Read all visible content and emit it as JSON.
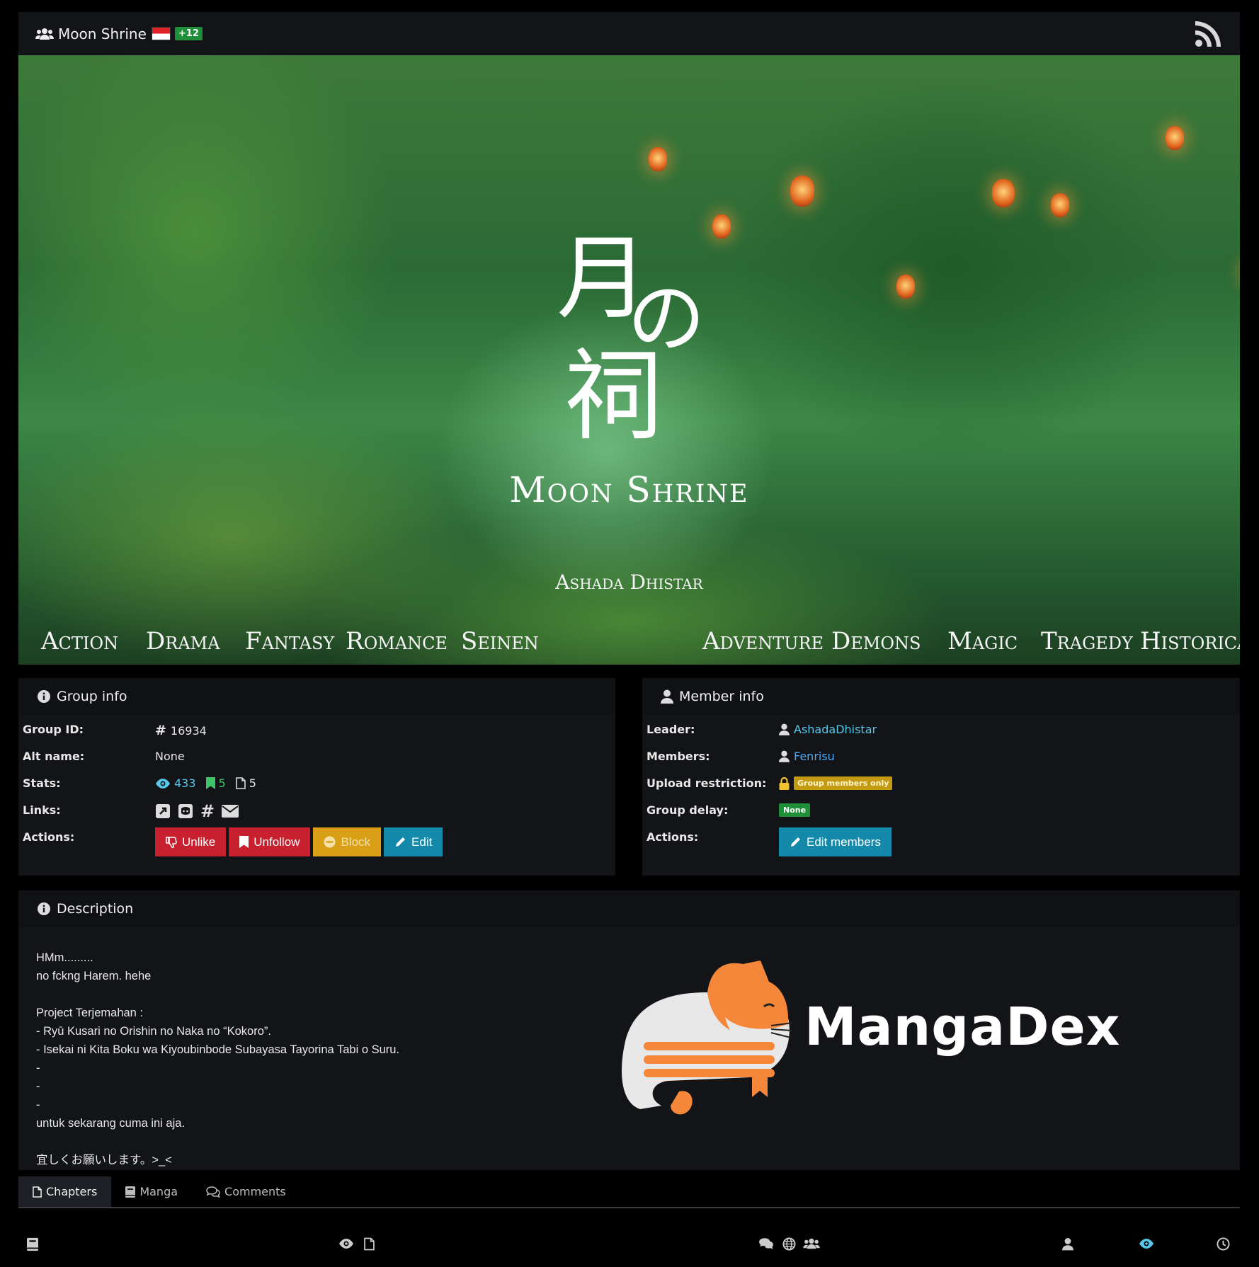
{
  "header": {
    "group_name": "Moon Shrine",
    "extra_languages": "+12"
  },
  "banner": {
    "title": "Moon Shrine",
    "author": "Ashada Dhistar",
    "genres": [
      "Action",
      "Drama",
      "Fantasy",
      "Romance",
      "Seinen",
      "Adventure",
      "Demons",
      "Magic",
      "Tragedy",
      "Historical"
    ]
  },
  "group_info": {
    "heading": "Group info",
    "labels": {
      "group_id": "Group ID:",
      "alt_name": "Alt name:",
      "stats": "Stats:",
      "links": "Links:",
      "actions": "Actions:"
    },
    "group_id": "16934",
    "alt_name": "None",
    "stats": {
      "views": "433",
      "follows": "5",
      "chapters": "5"
    },
    "buttons": {
      "unlike": "Unlike",
      "unfollow": "Unfollow",
      "block": "Block",
      "edit": "Edit"
    }
  },
  "member_info": {
    "heading": "Member info",
    "labels": {
      "leader": "Leader:",
      "members": "Members:",
      "upload_restriction": "Upload restriction:",
      "group_delay": "Group delay:",
      "actions": "Actions:"
    },
    "leader": "AshadaDhistar",
    "members": "Fenrisu",
    "upload_restriction": "Group members only",
    "group_delay": "None",
    "edit_members": "Edit members"
  },
  "description": {
    "heading": "Description",
    "text": "HMm.........\nno fckng Harem. hehe\n\nProject Terjemahan :\n- Ryū Kusari no Orishin no Naka no “Kokoro”.\n- Isekai ni Kita Boku wa Kiyoubinbode Subayasa Tayorina Tabi o Suru.\n-\n-\n-\nuntuk sekarang cuma ini aja.\n\n宜しくお願いします。>_<",
    "logo_text": "MangaDex"
  },
  "tabs": [
    {
      "label": "Chapters",
      "active": true
    },
    {
      "label": "Manga",
      "active": false
    },
    {
      "label": "Comments",
      "active": false
    }
  ],
  "colors": {
    "red": "#c8202f",
    "yellow": "#d9a017",
    "teal": "#1489a9",
    "green": "#1f8f3a",
    "link_blue": "#49a9f5",
    "accent_orange": "#f5873a"
  }
}
